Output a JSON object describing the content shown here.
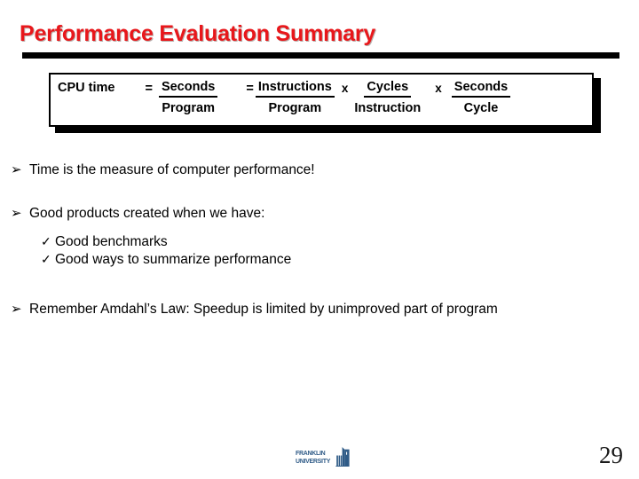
{
  "slide": {
    "title": "Performance Evaluation Summary",
    "title_color": "#e8171b",
    "rule_color": "#000000"
  },
  "formula": {
    "label": "CPU time",
    "eq1": "=",
    "frac1": {
      "numerator": "Seconds",
      "denominator": "Program"
    },
    "eq2": "=",
    "frac2": {
      "numerator": "Instructions",
      "denominator": "Program"
    },
    "mul1": "x",
    "frac3": {
      "numerator": "Cycles",
      "denominator": "Instruction"
    },
    "mul2": "x",
    "frac4": {
      "numerator": "Seconds",
      "denominator": "Cycle"
    }
  },
  "bullets": [
    {
      "marker": "➢",
      "text": "Time is the measure of computer performance!"
    },
    {
      "marker": "➢",
      "text": "Good products created when we have:",
      "sub": [
        {
          "marker": "✓",
          "text": "Good benchmarks"
        },
        {
          "marker": "✓",
          "text": "Good ways to summarize performance"
        }
      ]
    },
    {
      "marker": "➢",
      "text": "Remember Amdahl’s Law: Speedup is limited by unimproved part of program"
    }
  ],
  "footer": {
    "logo_line1": "FRANKLIN",
    "logo_line2": "UNIVERSITY",
    "logo_color": "#2f5b87",
    "page_number": "29"
  }
}
